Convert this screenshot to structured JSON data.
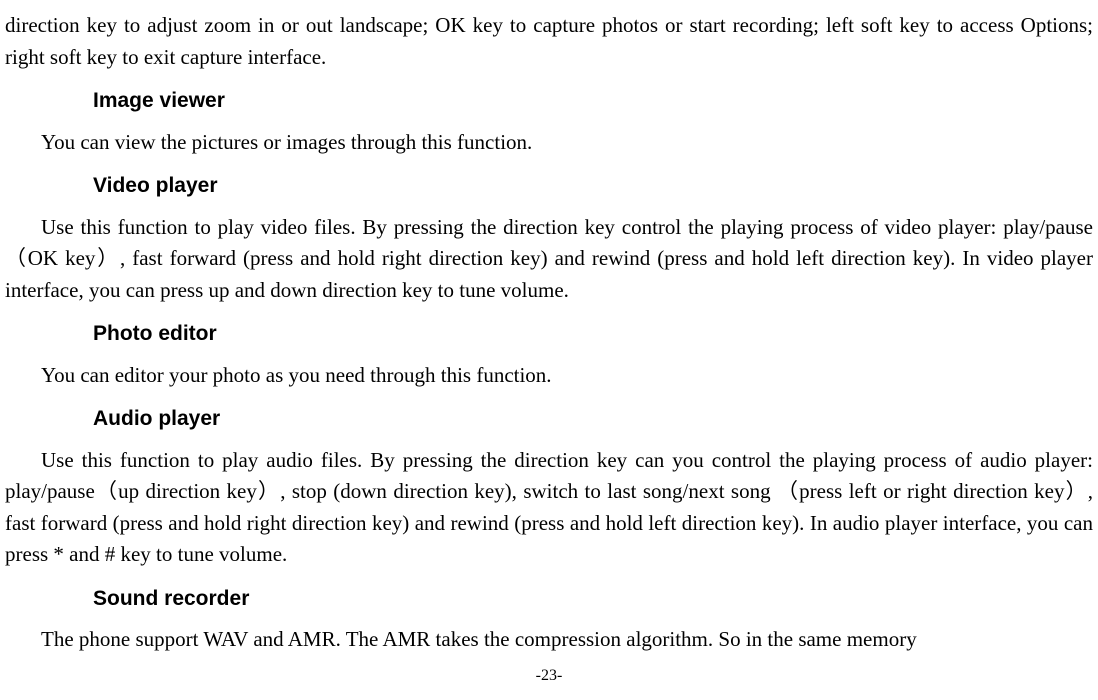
{
  "paragraphs": {
    "p1": "direction key to adjust zoom in or out landscape; OK key to capture photos or start recording; left soft key to access Options; right soft key to exit capture interface.",
    "p2": "You can view the pictures or images through this function.",
    "p3": "Use this function to play video files. By pressing the direction key control the playing process of video player: play/pause（OK key）, fast forward (press and hold right direction key) and rewind (press and hold left direction key). In video player interface, you can press up and down direction key to tune volume.",
    "p4": "You can editor your photo as you need through this function.",
    "p5": "Use this function to play audio files. By pressing the direction key can you control the playing process of audio player: play/pause（up direction key）, stop (down direction key), switch to last song/next song （press left or right direction key）, fast forward (press and hold right direction key) and rewind (press and hold left direction key). In audio player interface, you can press * and # key to tune volume.",
    "p6": "The phone support WAV and AMR. The AMR takes the compression algorithm. So in the same memory"
  },
  "headings": {
    "h1": "Image viewer",
    "h2": "Video player",
    "h3": "Photo editor",
    "h4": "Audio player",
    "h5": "Sound recorder"
  },
  "pageNumber": "-23-"
}
